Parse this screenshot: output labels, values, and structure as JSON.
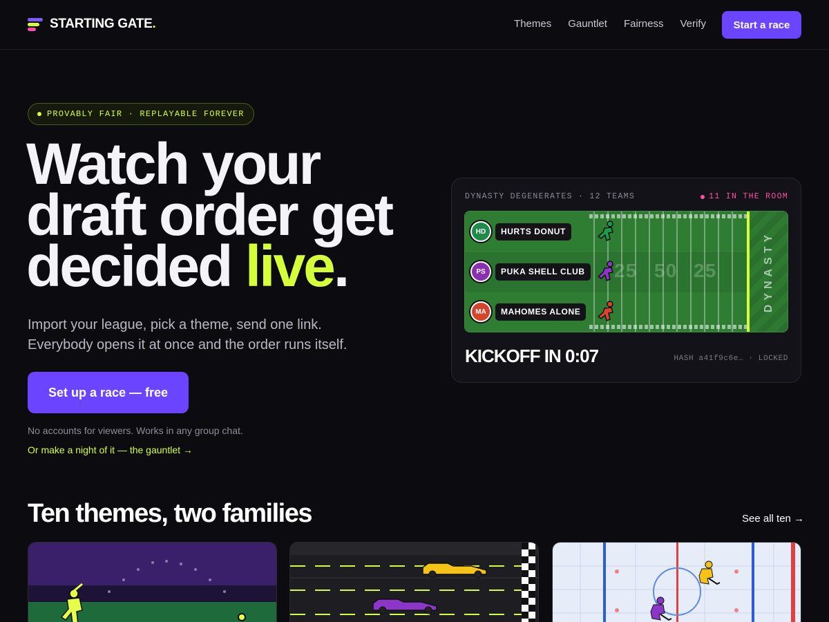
{
  "brand": {
    "name": "STARTING GATE",
    "dot": "."
  },
  "nav": {
    "links": [
      "Themes",
      "Gauntlet",
      "Fairness",
      "Verify"
    ],
    "cta": "Start a race"
  },
  "hero": {
    "pill": "PROVABLY FAIR · REPLAYABLE FOREVER",
    "headline_line1": "Watch your",
    "headline_line2": "draft order get",
    "headline_line3_a": "decided ",
    "headline_line3_highlight": "live",
    "headline_line3_end": ".",
    "subhead_line1": "Import your league, pick a theme, send one link.",
    "subhead_line2": "Everybody opens it at once and the order runs itself.",
    "cta": "Set up a race — free",
    "note": "No accounts for viewers. Works in any group chat.",
    "gauntlet_link": "Or make a night of it — the gauntlet →"
  },
  "race_card": {
    "league": "DYNASTY DEGENERATES · 12 TEAMS",
    "room": "11 IN THE ROOM",
    "yard_numbers": [
      "25",
      "50",
      "25"
    ],
    "endzone": "DYNASTY",
    "teams": [
      {
        "initials": "HD",
        "name": "HURTS DONUT",
        "color": "#1f8a4a",
        "runner_color": "#1e9a4a",
        "progress": 0.46
      },
      {
        "initials": "PS",
        "name": "PUKA SHELL CLUB",
        "color": "#8a2fb0",
        "runner_color": "#8b35c9",
        "progress": 0.46
      },
      {
        "initials": "MA",
        "name": "MAHOMES ALONE",
        "color": "#d4442a",
        "runner_color": "#d9452b",
        "progress": 0.46
      }
    ],
    "kickoff": "KICKOFF IN 0:07",
    "hash": "HASH a41f9c6e… · LOCKED"
  },
  "themes": {
    "title": "Ten themes, two families",
    "see_all": "See all ten →"
  },
  "colors": {
    "background": "#0c0c10",
    "accent_purple": "#6a44ff",
    "accent_lime": "#d4ff3a",
    "accent_pink": "#ff4fa3",
    "field_green": "#2f7d33"
  }
}
